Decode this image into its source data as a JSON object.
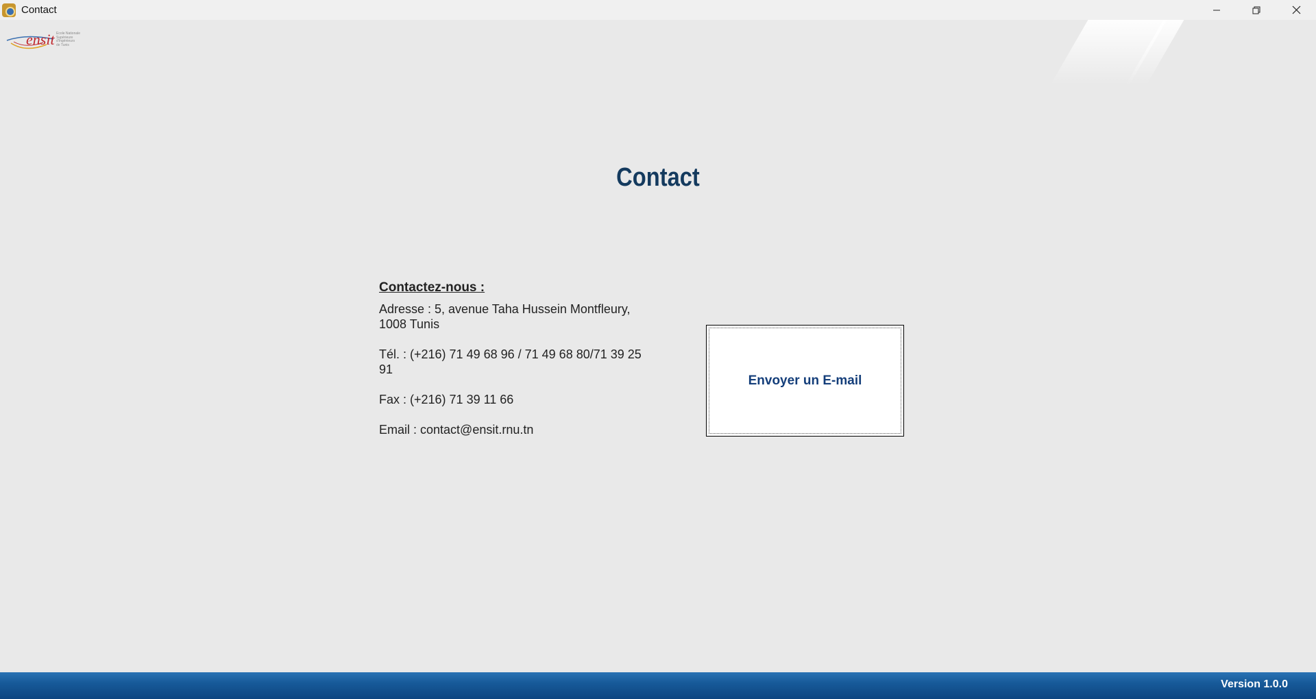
{
  "window": {
    "title": "Contact",
    "controls": {
      "minimize_icon": "minimize-icon",
      "maximize_icon": "restore-icon",
      "close_icon": "close-icon"
    }
  },
  "logo": {
    "name": "ensit",
    "subtitle_lines": [
      "Ecole Nationale",
      "Supérieure",
      "d'Ingénieurs",
      "de Tunis"
    ]
  },
  "page": {
    "title": "Contact"
  },
  "contact": {
    "heading": "Contactez-nous :",
    "address": "Adresse : 5, avenue Taha Hussein Montfleury, 1008 Tunis",
    "phone": "Tél. : (+216) 71 49 68 96 / 71 49 68 80/71 39 25 91",
    "fax": "Fax : (+216) 71 39 11 66",
    "email": "Email : contact@ensit.rnu.tn"
  },
  "actions": {
    "send_email_label": "Envoyer un E-mail"
  },
  "footer": {
    "version": "Version 1.0.0"
  },
  "colors": {
    "title": "#143a5e",
    "button_text": "#143e7a",
    "footer": "#175a99",
    "background": "#e9e9e9"
  }
}
